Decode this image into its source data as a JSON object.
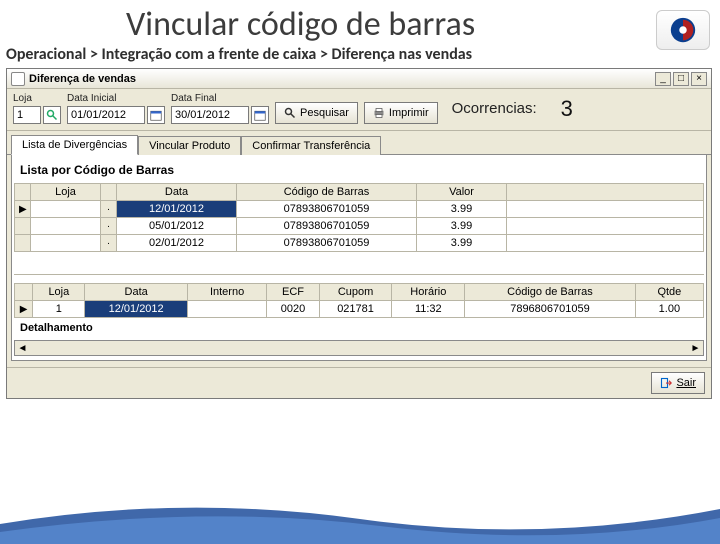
{
  "slide": {
    "title": "Vincular código de barras",
    "breadcrumb": "Operacional > Integração com a frente de caixa > Diferença nas vendas"
  },
  "window": {
    "title": "Diferença de vendas",
    "min": "_",
    "max": "□",
    "close": "×"
  },
  "toolbar": {
    "loja_label": "Loja",
    "loja_value": "1",
    "data_inicial_label": "Data Inicial",
    "data_inicial_value": "01/01/2012",
    "data_final_label": "Data Final",
    "data_final_value": "30/01/2012",
    "pesquisar": "Pesquisar",
    "imprimir": "Imprimir",
    "ocorrencias_label": "Ocorrencias:",
    "ocorrencias_value": "3"
  },
  "tabs": {
    "t1": "Lista de Divergências",
    "t2": "Vincular Produto",
    "t3": "Confirmar Transferência"
  },
  "grid1": {
    "heading": "Lista por Código de Barras",
    "cols": {
      "loja": "Loja",
      "data": "Data",
      "codigo": "Código de Barras",
      "valor": "Valor"
    },
    "rows": [
      {
        "loja": "",
        "data": "12/01/2012",
        "codigo": "07893806701059",
        "valor": "3.99",
        "sel": true
      },
      {
        "loja": "",
        "data": "05/01/2012",
        "codigo": "07893806701059",
        "valor": "3.99",
        "sel": false
      },
      {
        "loja": "",
        "data": "02/01/2012",
        "codigo": "07893806701059",
        "valor": "3.99",
        "sel": false
      }
    ]
  },
  "grid2": {
    "cols": {
      "loja": "Loja",
      "data": "Data",
      "interno": "Interno",
      "ecf": "ECF",
      "cupom": "Cupom",
      "horario": "Horário",
      "codigo": "Código de Barras",
      "qtde": "Qtde"
    },
    "row": {
      "loja": "1",
      "data": "12/01/2012",
      "interno": "",
      "ecf": "0020",
      "cupom": "021781",
      "horario": "11:32",
      "codigo": "7896806701059",
      "qtde": "1.00"
    }
  },
  "detalhe": "Detalhamento",
  "footer": {
    "sair": "Sair"
  }
}
